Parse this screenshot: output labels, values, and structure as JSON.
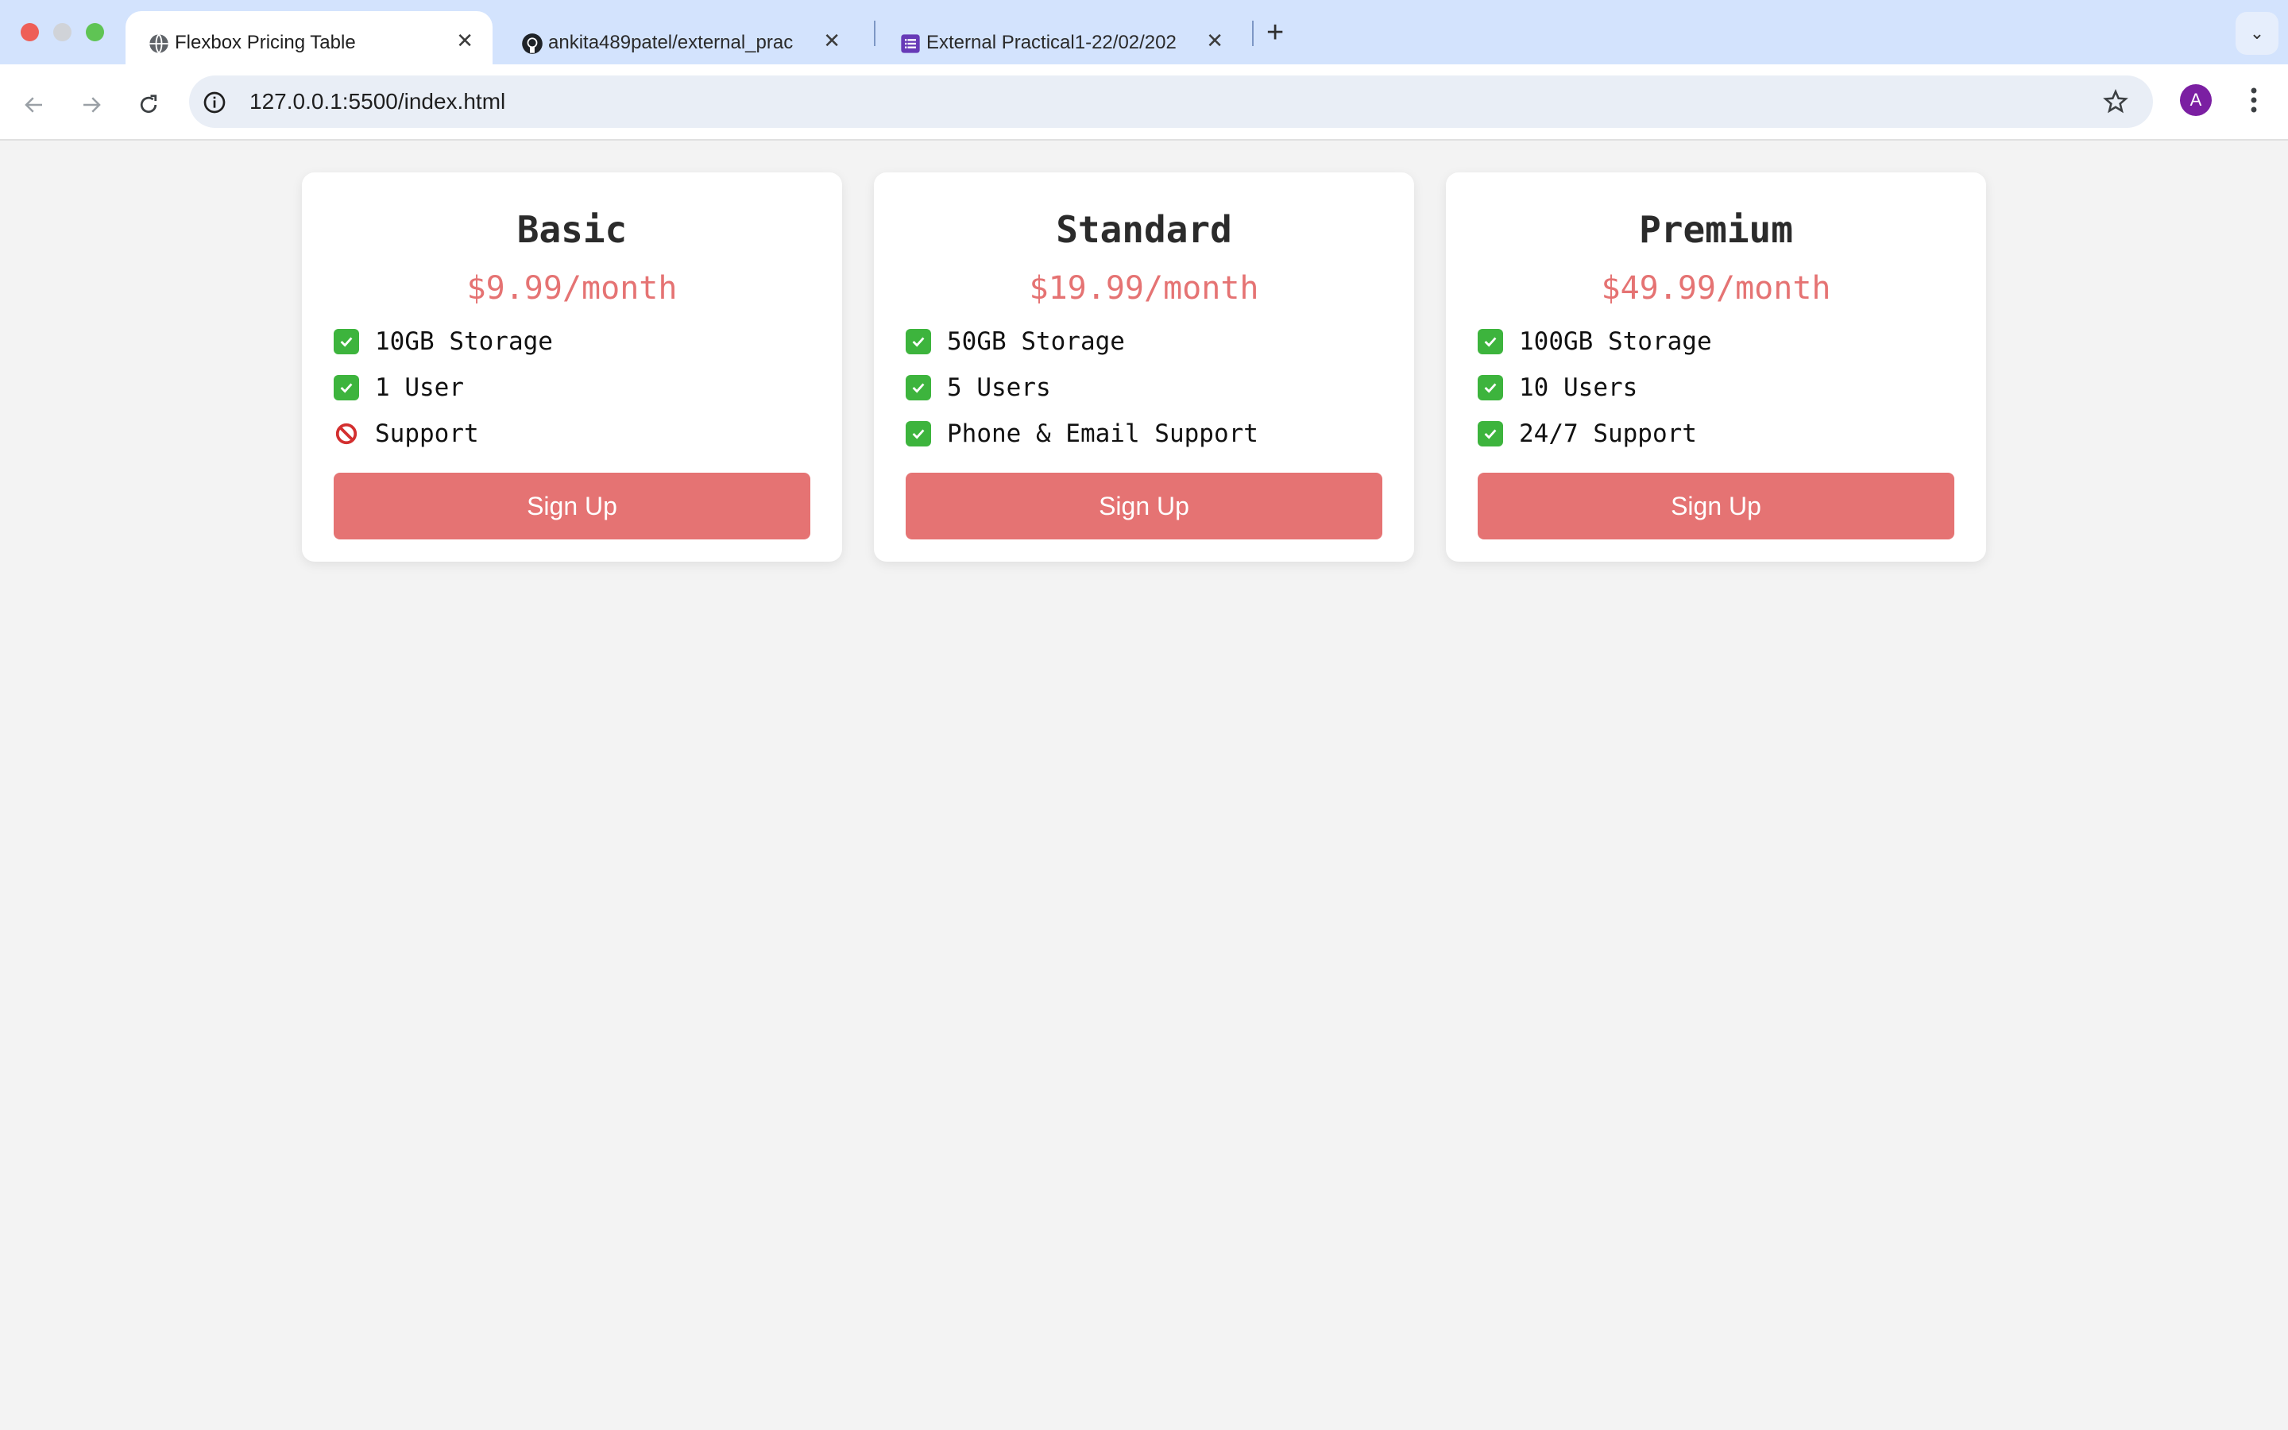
{
  "browser": {
    "tabs": [
      {
        "title": "Flexbox Pricing Table",
        "icon": "globe-icon",
        "active": true
      },
      {
        "title": "ankita489patel/external_prac",
        "icon": "github-icon",
        "active": false
      },
      {
        "title": "External Practical1-22/02/202",
        "icon": "forms-icon",
        "active": false
      }
    ],
    "address": "127.0.0.1:5500/index.html",
    "profile_initial": "A",
    "profile_color": "#7b1fa2"
  },
  "plans": [
    {
      "name": "Basic",
      "price": "$9.99/month",
      "features": [
        {
          "text": "10GB Storage",
          "icon": "check-icon"
        },
        {
          "text": "1 User",
          "icon": "check-icon"
        },
        {
          "text": "Support",
          "icon": "prohibited-icon"
        }
      ],
      "button": "Sign Up"
    },
    {
      "name": "Standard",
      "price": "$19.99/month",
      "features": [
        {
          "text": "50GB Storage",
          "icon": "check-icon"
        },
        {
          "text": "5 Users",
          "icon": "check-icon"
        },
        {
          "text": "Phone & Email Support",
          "icon": "check-icon"
        }
      ],
      "button": "Sign Up"
    },
    {
      "name": "Premium",
      "price": "$49.99/month",
      "features": [
        {
          "text": "100GB Storage",
          "icon": "check-icon"
        },
        {
          "text": "10 Users",
          "icon": "check-icon"
        },
        {
          "text": "24/7 Support",
          "icon": "check-icon"
        }
      ],
      "button": "Sign Up"
    }
  ],
  "colors": {
    "accent": "#e57373",
    "page_background": "#f3f3f3",
    "check": "#3db43d",
    "prohibited": "#d32f2f"
  }
}
